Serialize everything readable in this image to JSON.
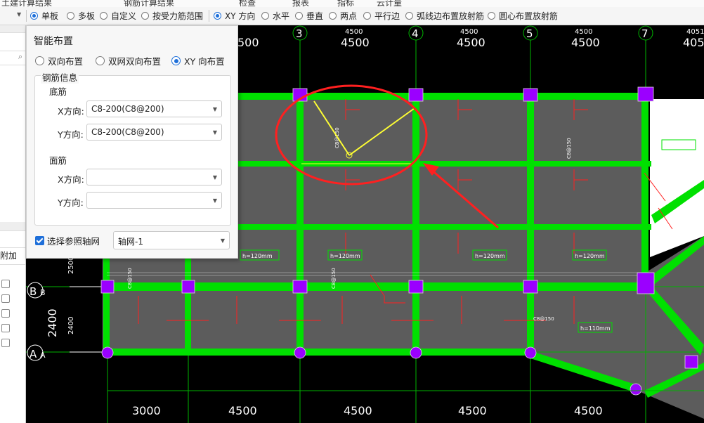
{
  "top_tabs": [
    "土建计算结果",
    "钢筋计算结果",
    "检查",
    "报表",
    "指标",
    "云计量"
  ],
  "toolbar": {
    "plate_modes": [
      {
        "label": "单板",
        "selected": true
      },
      {
        "label": "多板",
        "selected": false
      },
      {
        "label": "自定义",
        "selected": false
      },
      {
        "label": "按受力筋范围",
        "selected": false
      }
    ],
    "directions": [
      {
        "label": "XY 方向",
        "selected": true
      },
      {
        "label": "水平",
        "selected": false
      },
      {
        "label": "垂直",
        "selected": false
      },
      {
        "label": "两点",
        "selected": false
      },
      {
        "label": "平行边",
        "selected": false
      },
      {
        "label": "弧线边布置放射筋",
        "selected": false
      },
      {
        "label": "圆心布置放射筋",
        "selected": false
      }
    ]
  },
  "left_panel": {
    "header_label": "附加"
  },
  "dialog": {
    "title": "智能布置",
    "options": [
      {
        "label": "双向布置",
        "selected": false
      },
      {
        "label": "双网双向布置",
        "selected": false
      },
      {
        "label": "XY 向布置",
        "selected": true
      }
    ],
    "rebar_info": {
      "legend": "钢筋信息",
      "bottom": {
        "label": "底筋",
        "x_label": "X方向:",
        "x_value": "C8-200(C8@200)",
        "y_label": "Y方向:",
        "y_value": "C8-200(C8@200)"
      },
      "top": {
        "label": "面筋",
        "x_label": "X方向:",
        "x_value": "",
        "y_label": "Y方向:",
        "y_value": ""
      }
    },
    "ref_grid": {
      "label": "选择参照轴网",
      "checked": true,
      "value": "轴网-1"
    }
  },
  "drawing": {
    "axes_top": [
      "3",
      "4",
      "5",
      "7"
    ],
    "dims_top_small": [
      "4500",
      "4500",
      "4500",
      "4500",
      "4051"
    ],
    "dims_top_big": [
      "4500",
      "4500",
      "4500",
      "405"
    ],
    "dims_top_partial": "500",
    "dims_bottom": [
      "3000",
      "4500",
      "4500",
      "4500",
      "4500"
    ],
    "axes_left": [
      "B",
      "A"
    ],
    "dims_left_big": "2400",
    "dims_left_small": [
      "2500",
      "2400"
    ],
    "slab_labels": [
      "h=120mm",
      "h=120mm",
      "h=120mm",
      "h=120mm",
      "h=110mm"
    ],
    "rebar_tags": [
      "C8@150",
      "C8@150",
      "C8@150",
      "C8@150",
      "C8@150"
    ],
    "colors": {
      "beam": "#00e000",
      "slab": "#5c5c5c",
      "axis": "#00b400",
      "column": "#9b00ff",
      "highlight": "#ff2020",
      "rebar": "#ffff33"
    }
  }
}
